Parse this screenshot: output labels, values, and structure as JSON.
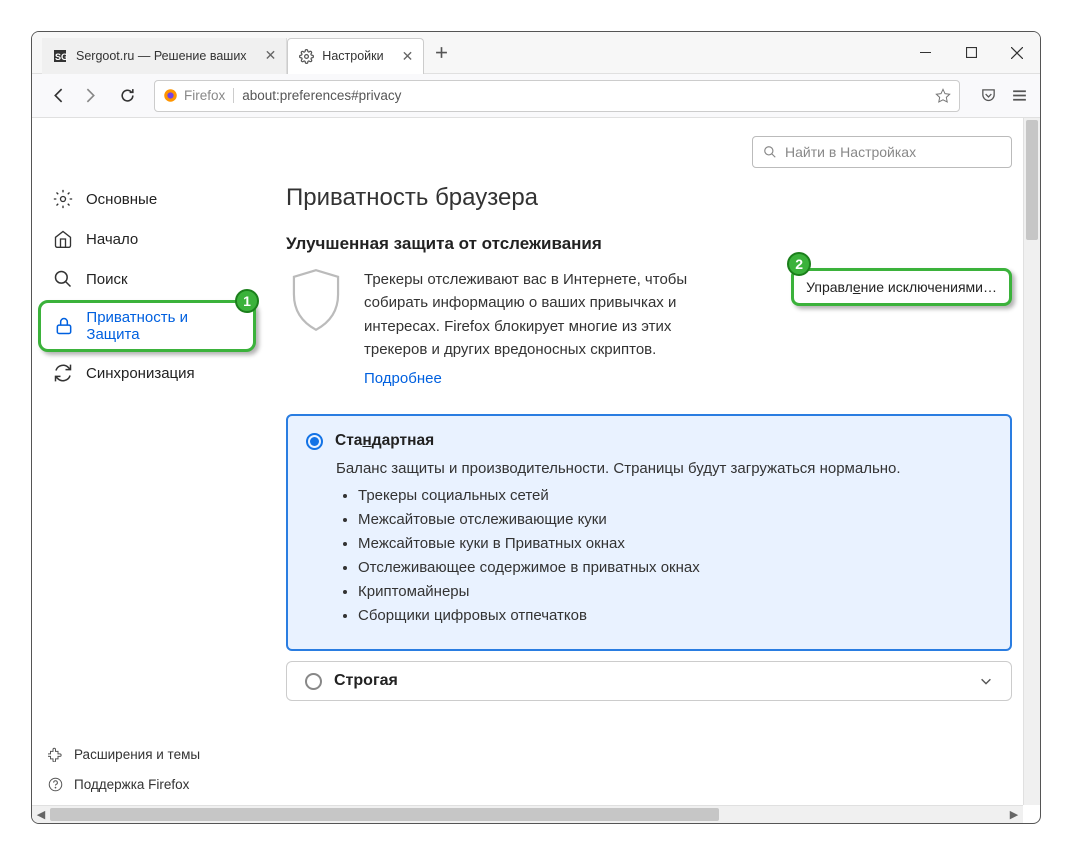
{
  "tabs": [
    {
      "label": "Sergoot.ru — Решение ваших"
    },
    {
      "label": "Настройки"
    }
  ],
  "url": {
    "identity": "Firefox",
    "value": "about:preferences#privacy"
  },
  "search": {
    "placeholder": "Найти в Настройках"
  },
  "sidebar": {
    "items": [
      {
        "label": "Основные"
      },
      {
        "label": "Начало"
      },
      {
        "label": "Поиск"
      },
      {
        "label": "Приватность и Защита"
      },
      {
        "label": "Синхронизация"
      }
    ],
    "footer": [
      {
        "label": "Расширения и темы"
      },
      {
        "label": "Поддержка Firefox"
      }
    ]
  },
  "badges": {
    "sidebar": "1",
    "exceptions": "2"
  },
  "page": {
    "title": "Приватность браузера",
    "section_title": "Улучшенная защита от отслеживания",
    "tracking_text": "Трекеры отслеживают вас в Интернете, чтобы собирать информацию о ваших привычках и интересах. Firefox блокирует многие из этих трекеров и других вредоносных скриптов.",
    "learn_more": "Подробнее",
    "exceptions_pre": "Управл",
    "exceptions_ul": "е",
    "exceptions_post": "ние исключениями…",
    "standard": {
      "label_pre": "Ста",
      "label_ul": "н",
      "label_post": "дартная",
      "desc": "Баланс защиты и производительности. Страницы будут загружаться нормально.",
      "items": [
        "Трекеры социальных сетей",
        "Межсайтовые отслеживающие куки",
        "Межсайтовые куки в Приватных окнах",
        "Отслеживающее содержимое в приватных окнах",
        "Криптомайнеры",
        "Сборщики цифровых отпечатков"
      ]
    },
    "strict": {
      "label_pre": "Стро",
      "label_ul": "г",
      "label_post": "ая"
    }
  }
}
